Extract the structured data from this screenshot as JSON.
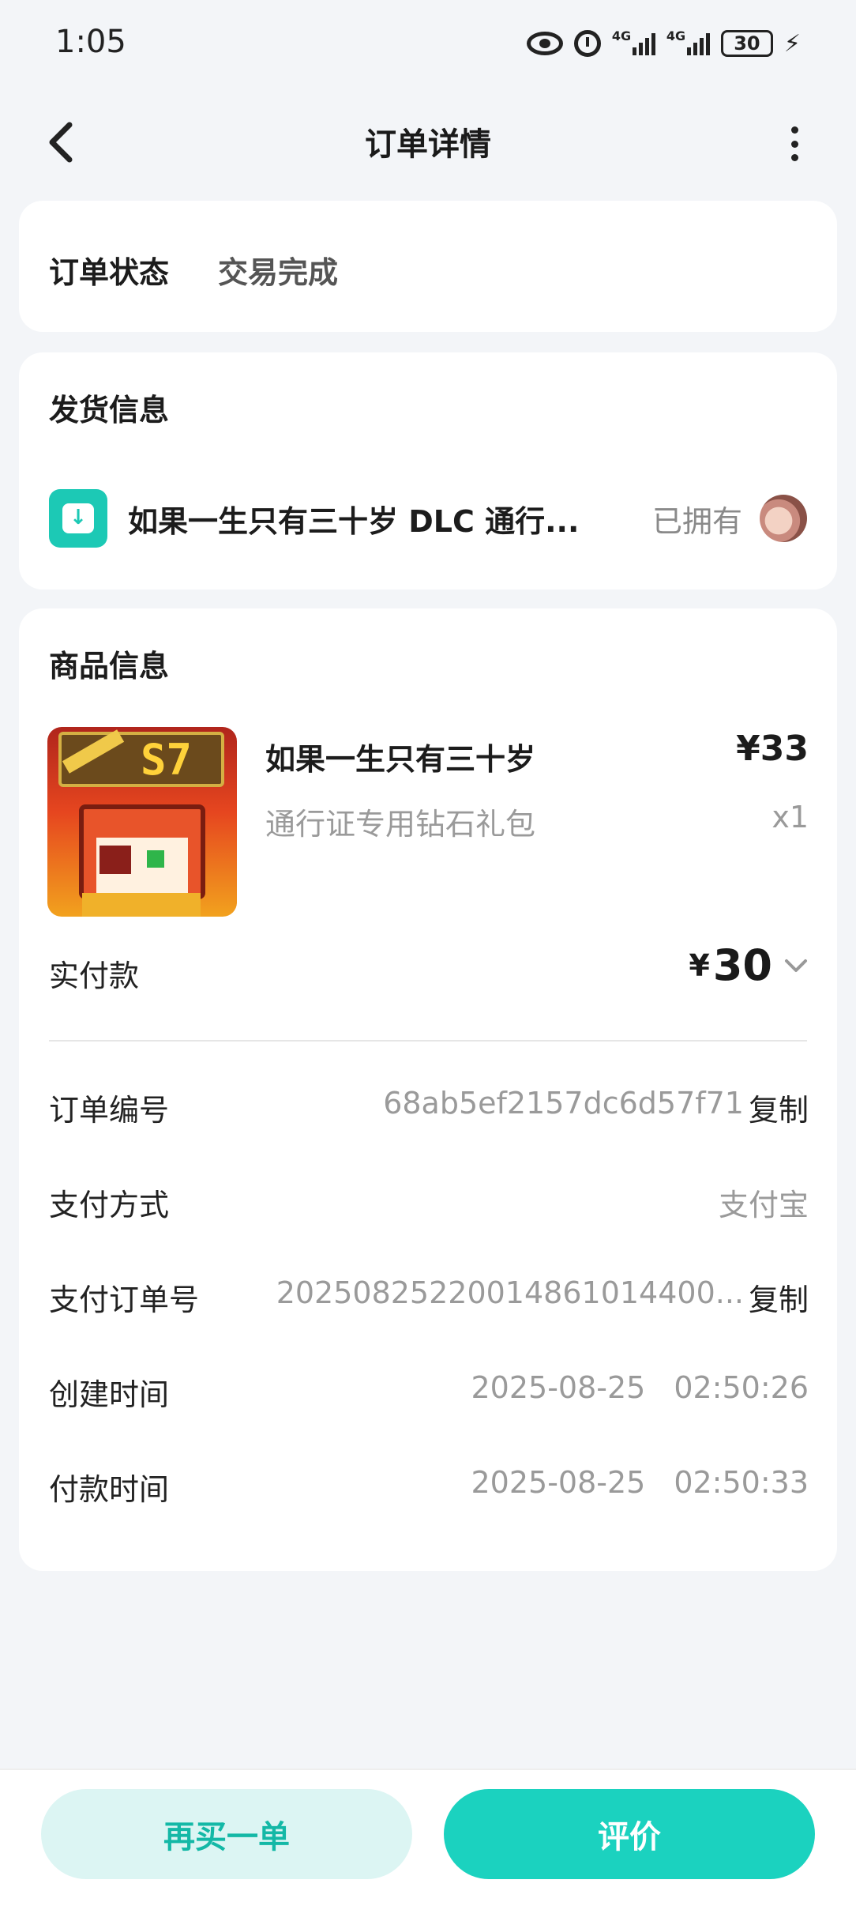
{
  "status_bar": {
    "time": "1:05",
    "network1": "4G",
    "network2": "4G",
    "battery": "30"
  },
  "header": {
    "title": "订单详情"
  },
  "order_status": {
    "label": "订单状态",
    "value": "交易完成"
  },
  "delivery": {
    "section_title": "发货信息",
    "item_name": "如果一生只有三十岁 DLC 通行...",
    "owned_text": "已拥有"
  },
  "product": {
    "section_title": "商品信息",
    "name": "如果一生只有三十岁",
    "price": "¥33",
    "subtitle": "通行证专用钻石礼包",
    "quantity": "x1",
    "thumb_badge": "S7"
  },
  "payment": {
    "actual_label": "实付款",
    "actual_currency": "¥",
    "actual_amount": "30"
  },
  "details": {
    "order_no_label": "订单编号",
    "order_no_value": "68ab5ef2157dc6d57f71",
    "copy_label": "复制",
    "pay_method_label": "支付方式",
    "pay_method_value": "支付宝",
    "pay_order_label": "支付订单号",
    "pay_order_value": "20250825220014861014400...",
    "created_label": "创建时间",
    "created_date": "2025-08-25",
    "created_time": "02:50:26",
    "paid_label": "付款时间",
    "paid_date": "2025-08-25",
    "paid_time": "02:50:33"
  },
  "actions": {
    "buy_again": "再买一单",
    "rate": "评价"
  },
  "colors": {
    "accent": "#1bd2bf",
    "accent_light": "#dcf5f3",
    "background": "#f3f5f8"
  }
}
